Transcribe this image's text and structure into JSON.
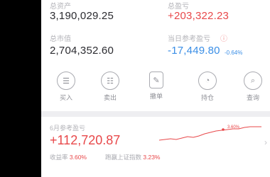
{
  "summary": {
    "total_assets_label": "总资产",
    "total_assets_value": "3,190,029.25",
    "total_pnl_label": "总盈亏",
    "total_pnl_value": "+203,322.23",
    "market_value_label": "总市值",
    "market_value_value": "2,704,352.60",
    "daily_pnl_label": "当日参考盈亏",
    "daily_pnl_value": "-17,449.80",
    "daily_pnl_pct": "-0.64%"
  },
  "actions": [
    {
      "label": "买入",
      "icon": "buy-icon",
      "glyph": "☰"
    },
    {
      "label": "卖出",
      "icon": "sell-icon",
      "glyph": "☷"
    },
    {
      "label": "撤单",
      "icon": "cancel-order-icon",
      "glyph": "✎"
    },
    {
      "label": "持仓",
      "icon": "position-pie-icon",
      "glyph": "◔"
    },
    {
      "label": "查询",
      "icon": "query-icon",
      "glyph": "⌕"
    }
  ],
  "monthly": {
    "label": "6月参考盈亏",
    "value": "+112,720.87",
    "return_label": "收益率",
    "return_value": "3.60%",
    "exceed_label": "跑赢上证指数",
    "exceed_value": "3.23%",
    "chart_point_label": "3.60%"
  },
  "colors": {
    "up": "#e8484a",
    "down": "#3a8ee6"
  }
}
